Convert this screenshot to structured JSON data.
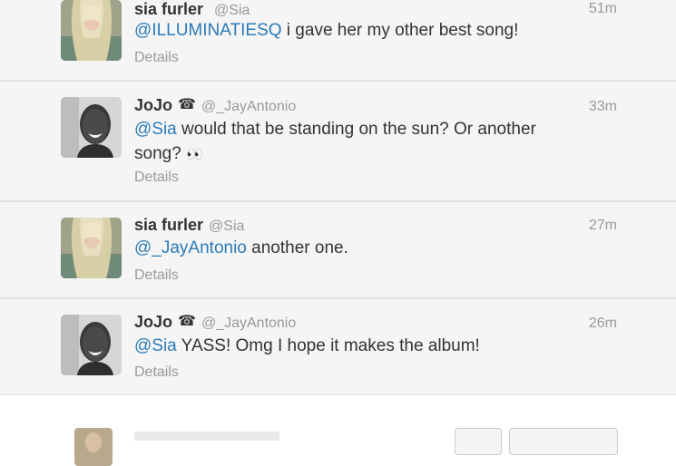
{
  "tweets": [
    {
      "avatar": "sia-avatar",
      "fullname": "sia furler",
      "badge": "",
      "username": "@Sia",
      "time": "51m",
      "mention": "@ILLUMINATIESQ",
      "body": " i gave her my other best song!",
      "body_extra": "",
      "details": "Details"
    },
    {
      "avatar": "jojo-avatar",
      "fullname": "JoJo",
      "badge": "☎",
      "username": "@_JayAntonio",
      "time": "33m",
      "mention": "@Sia",
      "body": " would that be standing on the sun? Or another song?",
      "body_extra": "👀",
      "details": "Details"
    },
    {
      "avatar": "sia-avatar",
      "fullname": "sia furler",
      "badge": "",
      "username": "@Sia",
      "time": "27m",
      "mention": "@_JayAntonio",
      "body": " another one.",
      "body_extra": "",
      "details": "Details"
    },
    {
      "avatar": "jojo-avatar",
      "fullname": "JoJo",
      "badge": "☎",
      "username": "@_JayAntonio",
      "time": "26m",
      "mention": "@Sia",
      "body": " YASS! Omg I hope it makes the album!",
      "body_extra": "",
      "details": "Details"
    }
  ],
  "colors": {
    "mention": "#2b7bb9",
    "meta": "#999999",
    "text": "#333333",
    "tweet_background": "#f5f5f5"
  }
}
